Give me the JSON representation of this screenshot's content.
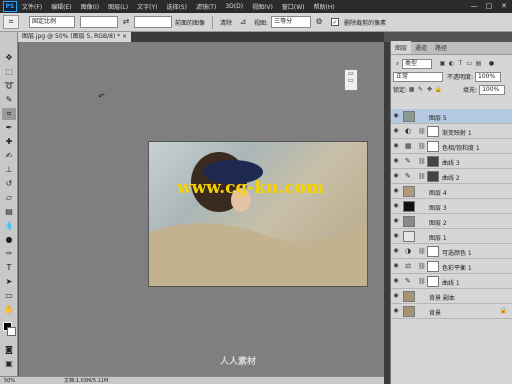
{
  "app": {
    "logo": "PS",
    "menu": [
      "文件(F)",
      "编辑(E)",
      "图像(I)",
      "图层(L)",
      "文字(Y)",
      "选择(S)",
      "滤镜(T)",
      "3D(D)",
      "视图(V)",
      "窗口(W)",
      "帮助(H)"
    ],
    "window_controls": [
      "—",
      "□",
      "✕"
    ]
  },
  "options": {
    "style_value": "固定比例",
    "width_value": "",
    "height_value": "",
    "resolution_label": "像素/英寸",
    "front_image_label": "前面的图像",
    "clear_label": "清除",
    "view_label": "视图:",
    "view_value": "三等分",
    "delete_cropped_label": "删除裁剪的像素"
  },
  "document": {
    "tab_title": "图层.jpg @ 50% (图层 5, RGB/8) *  ×"
  },
  "canvas": {
    "watermark": "www.cg-ku.com",
    "logo_text": "人人素材"
  },
  "status": {
    "zoom": "50%",
    "doc_info": "文档:1.03M/5.11M"
  },
  "layers_panel": {
    "tabs": [
      "图层",
      "通道",
      "路径"
    ],
    "kind_label": "类型",
    "blend_mode": "正常",
    "opacity_label": "不透明度:",
    "opacity_value": "100%",
    "lock_label": "锁定:",
    "fill_label": "填充:",
    "fill_value": "100%",
    "layers": [
      {
        "name": "图层 5",
        "thumb_color": "#8a9a8f"
      },
      {
        "name": "渐变映射 1",
        "adj_icon": "◐"
      },
      {
        "name": "色相/饱和度 1",
        "adj_icon": "▦"
      },
      {
        "name": "曲线 3",
        "adj_icon": "✎"
      },
      {
        "name": "曲线 2",
        "adj_icon": "✎"
      },
      {
        "name": "图层 4",
        "thumb_color": "#b09a7e"
      },
      {
        "name": "图层 3",
        "thumb_color": "#111111"
      },
      {
        "name": "图层 2",
        "thumb_color": "#888888"
      },
      {
        "name": "图层 1",
        "thumb_color": "#e6e6e6"
      },
      {
        "name": "可选颜色 1",
        "adj_icon": "◑"
      },
      {
        "name": "色彩平衡 1",
        "adj_icon": "⚖"
      },
      {
        "name": "曲线 1",
        "adj_icon": "✎"
      },
      {
        "name": "背景 副本",
        "thumb_color": "#a69274"
      },
      {
        "name": "背景",
        "thumb_color": "#a69274"
      }
    ]
  },
  "colors": {
    "selected_layer": "#b5c8e4",
    "watermark": "#f4d300"
  }
}
